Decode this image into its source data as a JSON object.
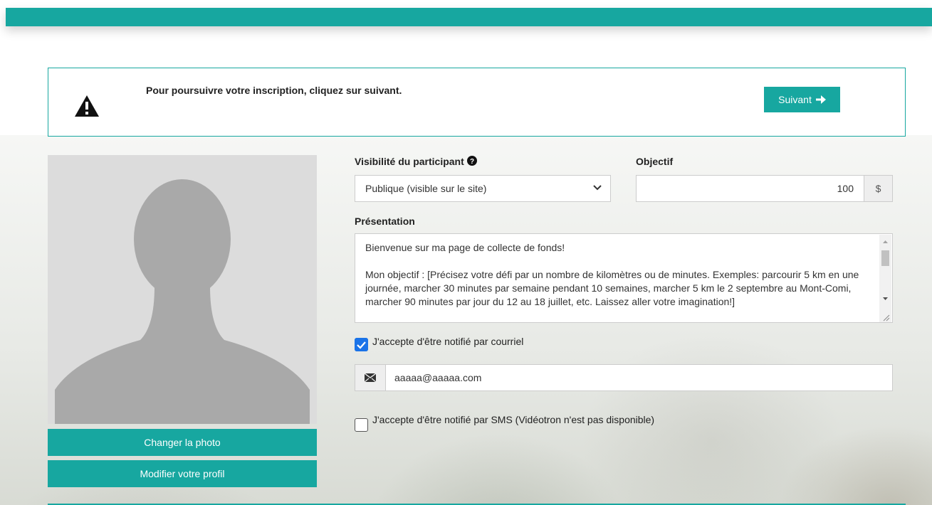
{
  "colors": {
    "accent": "#17a7a0",
    "checkbox_checked": "#1a73e8"
  },
  "notice": {
    "icon": "warning-icon",
    "message": "Pour poursuivre votre inscription, cliquez sur suivant.",
    "next_label": "Suivant"
  },
  "profile": {
    "photo_icon": "avatar-placeholder-icon",
    "change_photo_label": "Changer la photo",
    "edit_profile_label": "Modifier votre profil"
  },
  "form": {
    "visibility": {
      "label": "Visibilité du participant",
      "help_icon": "question-circle-icon",
      "selected": "Publique (visible sur le site)"
    },
    "goal": {
      "label": "Objectif",
      "value": "100",
      "currency": "$"
    },
    "presentation": {
      "label": "Présentation",
      "line1": "Bienvenue sur ma page de collecte de fonds!",
      "line2": "Mon objectif : [Précisez votre défi par un nombre de kilomètres ou de minutes. Exemples: parcourir 5 km en une journée, marcher 30 minutes par semaine pendant 10 semaines, marcher 5 km le 2 septembre au Mont-Comi, marcher 90 minutes par jour du 12 au 18 juillet, etc. Laissez aller votre imagination!]"
    },
    "email_opt_in": {
      "label": "J'accepte d'être notifié par courriel",
      "checked": true
    },
    "email": {
      "icon": "envelope-icon",
      "value": "aaaaa@aaaaa.com"
    },
    "sms_opt_in": {
      "label": "J'accepte d'être notifié par SMS (Vidéotron n'est pas disponible)",
      "checked": false
    }
  }
}
